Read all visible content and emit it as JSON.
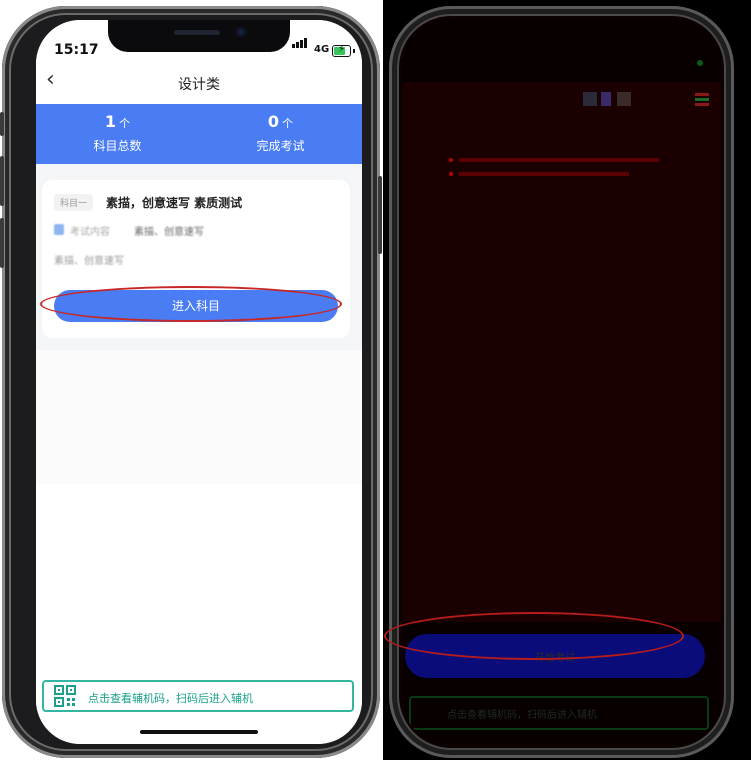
{
  "left_phone": {
    "status_bar": {
      "time": "15:17",
      "network": "4G"
    },
    "nav": {
      "back_icon": "chevron-left-icon",
      "title": "设计类"
    },
    "stats": [
      {
        "value": "1",
        "unit": "个",
        "label": "科目总数"
      },
      {
        "value": "0",
        "unit": "个",
        "label": "完成考试"
      }
    ],
    "subject_card": {
      "badge": "科目一",
      "title": "素描，创意速写  素质测试",
      "exam_content_label": "考试内容",
      "exam_content_value": "素描、创意速写",
      "description": "素描、创意速写",
      "enter_button": "进入科目"
    },
    "qr_bar": {
      "icon": "qr-code-icon",
      "text": "点击查看辅机码，扫码后进入辅机"
    }
  },
  "right_phone": {
    "start_button": "开始考试"
  },
  "colors": {
    "primary_blue": "#4a7cf3",
    "annotation_red": "#c62828",
    "qr_teal": "#33b5a0"
  }
}
